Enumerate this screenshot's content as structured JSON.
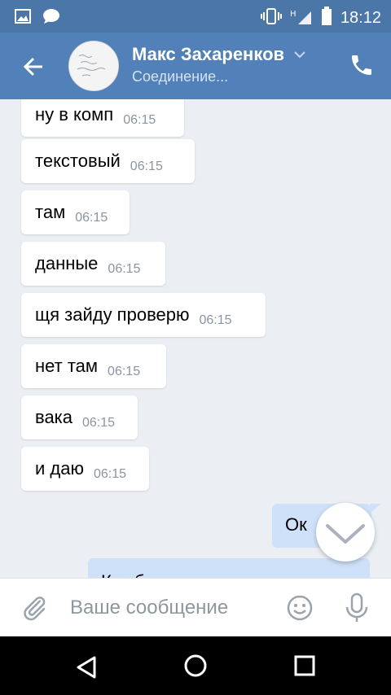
{
  "status_bar": {
    "time": "18:12",
    "network": "H"
  },
  "header": {
    "name": "Макс Захаренков",
    "subtitle": "Соединение..."
  },
  "messages": [
    {
      "text": "ну в комп",
      "time": "06:15"
    },
    {
      "text": "текстовый",
      "time": "06:15"
    },
    {
      "text": "там",
      "time": "06:15"
    },
    {
      "text": "данные",
      "time": "06:15"
    },
    {
      "text": "щя зайду проверю",
      "time": "06:15"
    },
    {
      "text": "нет там",
      "time": "06:15"
    },
    {
      "text": "вака",
      "time": "06:15"
    },
    {
      "text": "и даю",
      "time": "06:15"
    }
  ],
  "outgoing": [
    {
      "text": "Ок"
    },
    {
      "text": "Как бы говоришь в компо"
    }
  ],
  "composer": {
    "placeholder": "Ваше сообщение"
  },
  "colors": {
    "header": "#5181b8",
    "status_bar": "#4a76a8",
    "incoming_bubble": "#ffffff",
    "outgoing_bubble": "#cfe1f8",
    "background": "#ebeff3"
  },
  "icons": [
    "gallery-icon",
    "chat-icon",
    "vibrate-icon",
    "signal-icon",
    "battery-icon",
    "back-arrow-icon",
    "chevron-down-icon",
    "phone-icon",
    "scroll-down-icon",
    "paperclip-icon",
    "emoji-icon",
    "microphone-icon",
    "nav-back-icon",
    "nav-home-icon",
    "nav-recents-icon"
  ]
}
